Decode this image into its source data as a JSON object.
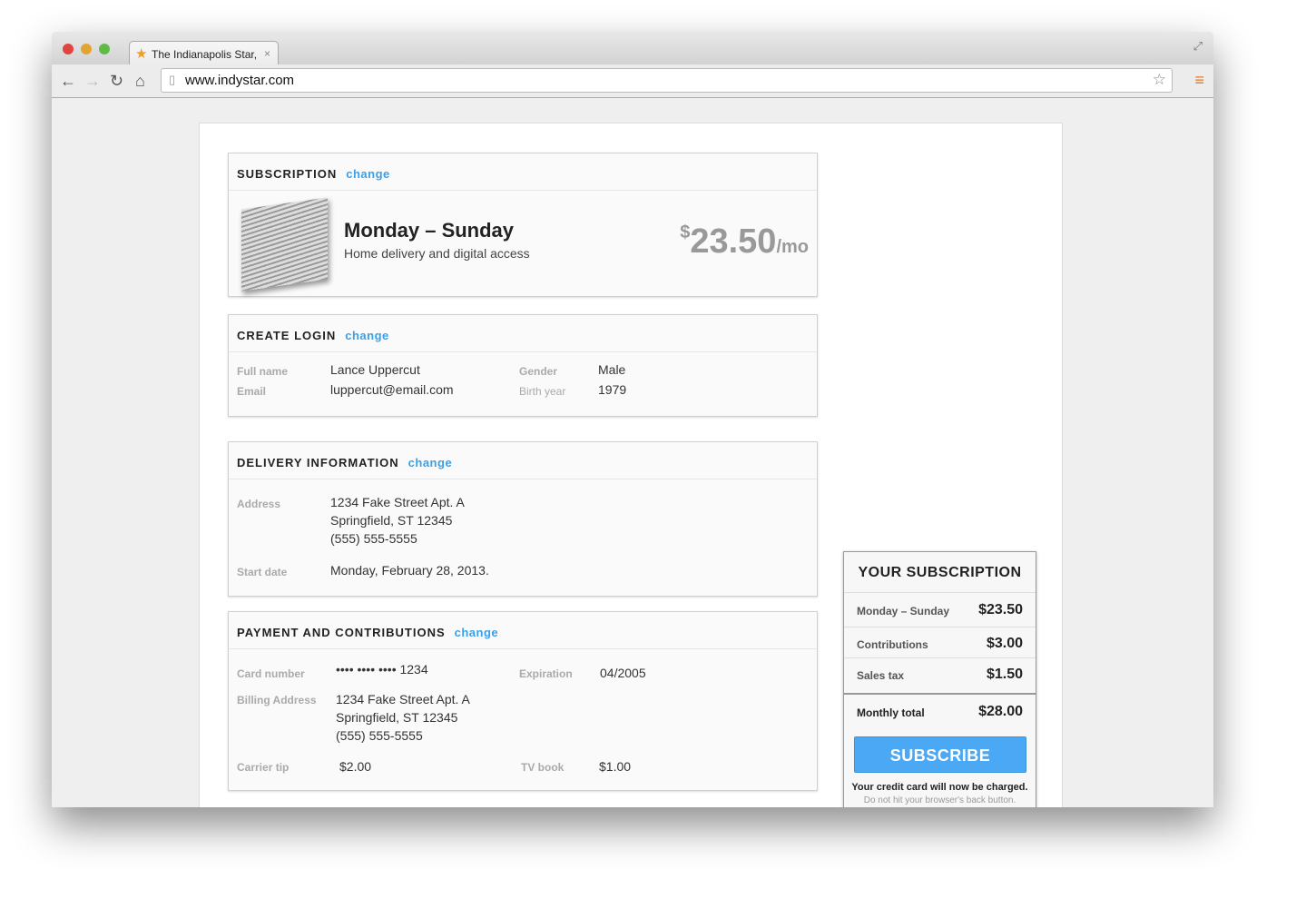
{
  "browser": {
    "tab_title": "The Indianapolis Star,",
    "url": "www.indystar.com"
  },
  "subscription": {
    "heading": "SUBSCRIPTION",
    "change": "change",
    "plan": "Monday – Sunday",
    "desc": "Home delivery and digital access",
    "currency": "$",
    "price": "23.50",
    "per": "/mo"
  },
  "login": {
    "heading": "CREATE LOGIN",
    "change": "change",
    "full_name_label": "Full name",
    "full_name": "Lance Uppercut",
    "email_label": "Email",
    "email": "luppercut@email.com",
    "gender_label": "Gender",
    "gender": "Male",
    "birth_label": "Birth year",
    "birth": "1979"
  },
  "delivery": {
    "heading": "DELIVERY INFORMATION",
    "change": "change",
    "address_label": "Address",
    "address": [
      "1234 Fake Street Apt. A",
      "Springfield, ST 12345",
      "(555) 555-5555"
    ],
    "start_label": "Start date",
    "start": "Monday, February 28, 2013."
  },
  "payment": {
    "heading": "PAYMENT AND CONTRIBUTIONS",
    "change": "change",
    "card_label": "Card number",
    "card": "•••• •••• •••• 1234",
    "exp_label": "Expiration",
    "exp": "04/2005",
    "billing_label": "Billing Address",
    "billing": [
      "1234 Fake Street Apt. A",
      "Springfield, ST 12345",
      "(555) 555-5555"
    ],
    "tip_label": "Carrier tip",
    "tip": "$2.00",
    "tv_label": "TV book",
    "tv": "$1.00"
  },
  "summary": {
    "title": "YOUR SUBSCRIPTION",
    "rows": [
      {
        "label": "Monday – Sunday",
        "amount": "$23.50"
      },
      {
        "label": "Contributions",
        "amount": "$3.00"
      },
      {
        "label": "Sales tax",
        "amount": "$1.50"
      }
    ],
    "total_label": "Monthly total",
    "total": "$28.00",
    "button": "SUBSCRIBE",
    "warn": "Your credit card will now be charged.",
    "note": "Do not hit your browser's back button."
  },
  "colors": {
    "accent": "#3aa0e8",
    "button": "#4aa8f4"
  }
}
